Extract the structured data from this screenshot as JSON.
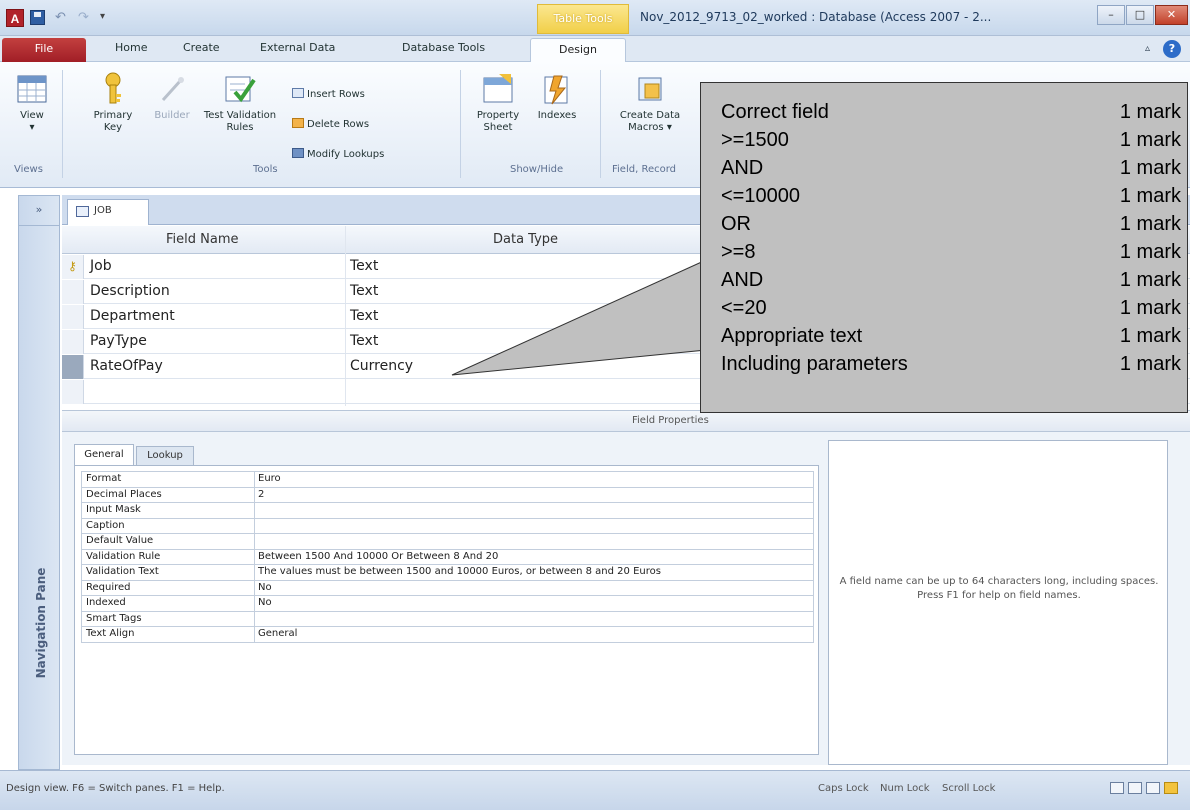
{
  "titlebar": {
    "app_icon_letter": "A",
    "contextual_tab": "Table Tools",
    "window_title": "Nov_2012_9713_02_worked : Database (Access 2007 - 2..."
  },
  "ribbon_tabs": [
    "File",
    "Home",
    "Create",
    "External Data",
    "Database Tools",
    "Design"
  ],
  "ribbon": {
    "view_label": "View",
    "views_group": "Views",
    "primary_key_label": "Primary Key",
    "builder_label": "Builder",
    "test_validation_label": "Test Validation Rules",
    "insert_rows": "Insert Rows",
    "delete_rows": "Delete Rows",
    "modify_lookups": "Modify Lookups",
    "tools_group": "Tools",
    "property_sheet_label": "Property Sheet",
    "indexes_label": "Indexes",
    "showhide_group": "Show/Hide",
    "create_data_macros_label": "Create Data Macros",
    "field_record_group": "Field, Record"
  },
  "nav_pane": {
    "toggle": "»",
    "label": "Navigation Pane"
  },
  "document": {
    "tab_label": "JOB",
    "headers": {
      "field_name": "Field Name",
      "data_type": "Data Type"
    },
    "fields": [
      {
        "name": "Job",
        "type": "Text"
      },
      {
        "name": "Description",
        "type": "Text"
      },
      {
        "name": "Department",
        "type": "Text"
      },
      {
        "name": "PayType",
        "type": "Text"
      },
      {
        "name": "RateOfPay",
        "type": "Currency"
      }
    ],
    "field_properties_label": "Field Properties"
  },
  "properties": {
    "tabs": [
      "General",
      "Lookup"
    ],
    "rows": [
      {
        "label": "Format",
        "value": "Euro"
      },
      {
        "label": "Decimal Places",
        "value": "2"
      },
      {
        "label": "Input Mask",
        "value": ""
      },
      {
        "label": "Caption",
        "value": ""
      },
      {
        "label": "Default Value",
        "value": ""
      },
      {
        "label": "Validation Rule",
        "value": "Between 1500 And 10000 Or Between 8 And 20"
      },
      {
        "label": "Validation Text",
        "value": "The values must be between 1500 and 10000 Euros, or between 8 and 20 Euros"
      },
      {
        "label": "Required",
        "value": "No"
      },
      {
        "label": "Indexed",
        "value": "No"
      },
      {
        "label": "Smart Tags",
        "value": ""
      },
      {
        "label": "Text Align",
        "value": "General"
      }
    ],
    "help_text": "A field name can be up to 64 characters long, including spaces. Press F1 for help on field names."
  },
  "statusbar": {
    "text": "Design view.  F6 = Switch panes.  F1 = Help.",
    "caps_lock": "Caps Lock",
    "num_lock": "Num Lock",
    "scroll_lock": "Scroll Lock"
  },
  "mark_scheme": [
    {
      "criterion": "Correct field",
      "mark": "1 mark"
    },
    {
      "criterion": ">=1500",
      "mark": "1 mark"
    },
    {
      "criterion": "AND",
      "mark": "1 mark"
    },
    {
      "criterion": "<=10000",
      "mark": "1 mark"
    },
    {
      "criterion": "OR",
      "mark": "1 mark"
    },
    {
      "criterion": ">=8",
      "mark": "1 mark"
    },
    {
      "criterion": "AND",
      "mark": "1 mark"
    },
    {
      "criterion": "<=20",
      "mark": "1 mark"
    },
    {
      "criterion": "Appropriate text",
      "mark": "1 mark"
    },
    {
      "criterion": "Including parameters",
      "mark": "1 mark"
    }
  ],
  "colors": {
    "file_tab": "#a11e26",
    "contextual": "#f1cf48",
    "callout": "#c0c0c0"
  }
}
